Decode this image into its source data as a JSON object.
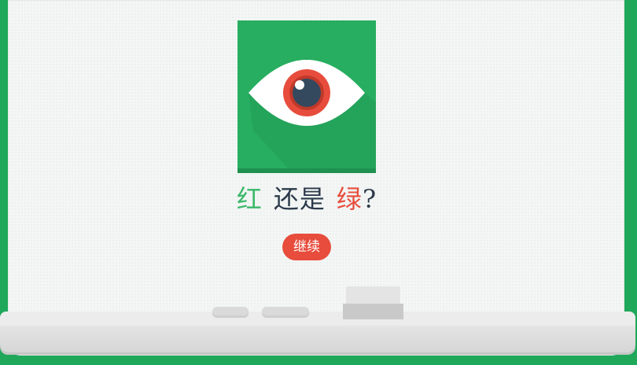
{
  "question": {
    "word_red": "红",
    "connector": "还是",
    "word_green": "绿",
    "question_mark": "?"
  },
  "continue_label": "继续",
  "colors": {
    "background": "#1fa85a",
    "logo_green": "#27ae60",
    "word_red_color": "#3bb86a",
    "word_green_color": "#e74c3c",
    "button": "#e74c3c",
    "text_dark": "#2c3a4b"
  },
  "icons": {
    "logo": "eye-icon"
  }
}
